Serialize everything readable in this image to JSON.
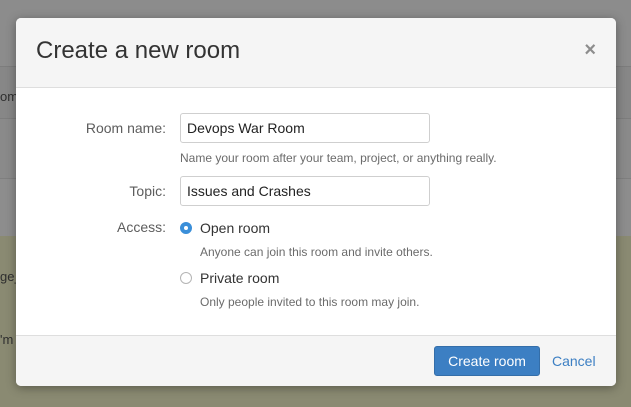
{
  "background": {
    "fragments": [
      "om",
      "ge_",
      "'m"
    ]
  },
  "modal": {
    "title": "Create a new room",
    "close_glyph": "×",
    "room_name": {
      "label": "Room name:",
      "value": "Devops War Room",
      "help": "Name your room after your team, project, or anything really."
    },
    "topic": {
      "label": "Topic:",
      "value": "Issues and Crashes"
    },
    "access": {
      "label": "Access:",
      "options": [
        {
          "label": "Open room",
          "help": "Anyone can join this room and invite others.",
          "checked": true
        },
        {
          "label": "Private room",
          "help": "Only people invited to this room may join.",
          "checked": false
        }
      ]
    },
    "footer": {
      "primary_label": "Create room",
      "cancel_label": "Cancel"
    }
  },
  "colors": {
    "accent": "#3c7fc3",
    "radio_checked": "#3a8fd9",
    "overlay": "#8a8a8a"
  }
}
